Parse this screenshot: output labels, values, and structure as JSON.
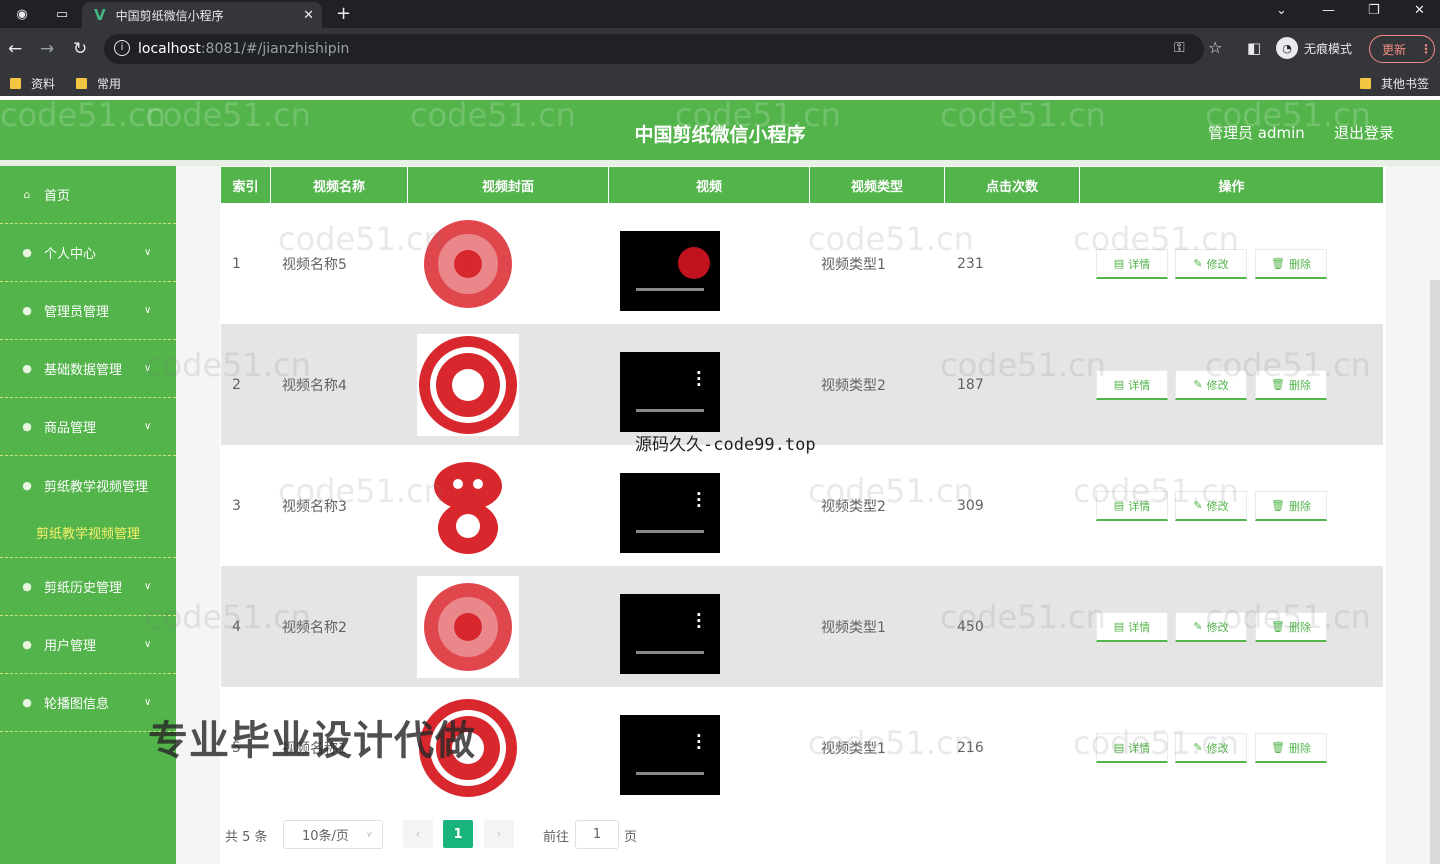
{
  "browser": {
    "tab_title": "中国剪纸微信小程序",
    "url_host": "localhost",
    "url_rest": ":8081/#/jianzhishipin",
    "incognito_label": "无痕模式",
    "update_label": "更新",
    "bookmarks": [
      "资料",
      "常用"
    ],
    "other_bookmarks": "其他书签"
  },
  "header": {
    "title": "中国剪纸微信小程序",
    "user": "管理员 admin",
    "logout": "退出登录"
  },
  "sidebar": {
    "items": [
      {
        "label": "首页"
      },
      {
        "label": "个人中心"
      },
      {
        "label": "管理员管理"
      },
      {
        "label": "基础数据管理"
      },
      {
        "label": "商品管理"
      },
      {
        "label": "剪纸教学视频管理"
      }
    ],
    "subitem": "剪纸教学视频管理",
    "items2": [
      {
        "label": "剪纸历史管理"
      },
      {
        "label": "用户管理"
      },
      {
        "label": "轮播图信息"
      }
    ]
  },
  "table": {
    "headers": [
      "索引",
      "视频名称",
      "视频封面",
      "视频",
      "视频类型",
      "点击次数",
      "操作"
    ],
    "rows": [
      {
        "index": "1",
        "name": "视频名称5",
        "type": "视频类型1",
        "clicks": "231"
      },
      {
        "index": "2",
        "name": "视频名称4",
        "type": "视频类型2",
        "clicks": "187"
      },
      {
        "index": "3",
        "name": "视频名称3",
        "type": "视频类型2",
        "clicks": "309"
      },
      {
        "index": "4",
        "name": "视频名称2",
        "type": "视频类型1",
        "clicks": "450"
      },
      {
        "index": "5",
        "name": "视频名称1",
        "type": "视频类型1",
        "clicks": "216"
      }
    ],
    "actions": {
      "detail": "详情",
      "edit": "修改",
      "delete": "删除"
    }
  },
  "pager": {
    "total": "共 5 条",
    "page_size": "10条/页",
    "current": "1",
    "goto_prefix": "前往",
    "goto_value": "1",
    "goto_suffix": "页"
  },
  "overlay": {
    "watermark": "code51.cn",
    "stamp": "源码久久-code99.top",
    "banner": "专业毕业设计代做"
  },
  "colors": {
    "primary": "#53b44b",
    "accent": "#18b47b",
    "red": "#d9272e"
  }
}
